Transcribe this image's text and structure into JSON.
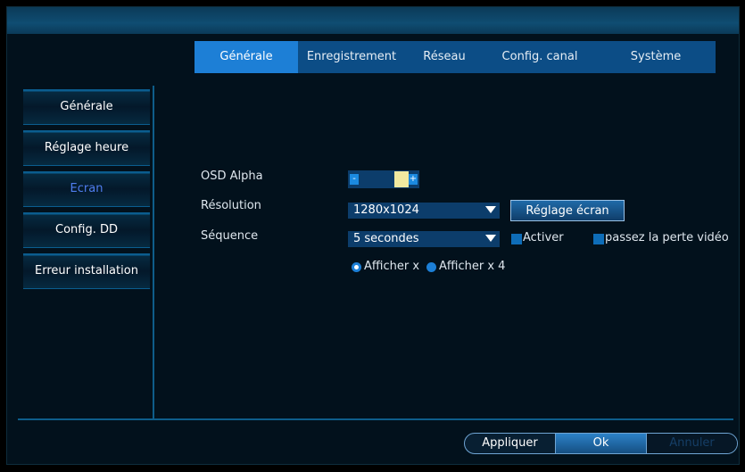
{
  "tabs": [
    "Générale",
    "Enregistrement",
    "Réseau",
    "Config. canal",
    "Système"
  ],
  "sidebar": [
    "Générale",
    "Réglage heure",
    "Ecran",
    "Config. DD",
    "Erreur installation"
  ],
  "form": {
    "osd_alpha_label": "OSD Alpha",
    "osd_alpha_minus": "-",
    "osd_alpha_plus": "+",
    "resolution_label": "Résolution",
    "resolution_value": "1280x1024",
    "screen_setting_button": "Réglage écran",
    "sequence_label": "Séquence",
    "sequence_value": "5 secondes",
    "activate_label": "Activer",
    "video_loss_label": "passez la perte vidéo",
    "radio1_label": "Afficher x",
    "radio2_label": "Afficher x 4"
  },
  "footer": [
    "Appliquer",
    "Ok",
    "Annuler"
  ]
}
